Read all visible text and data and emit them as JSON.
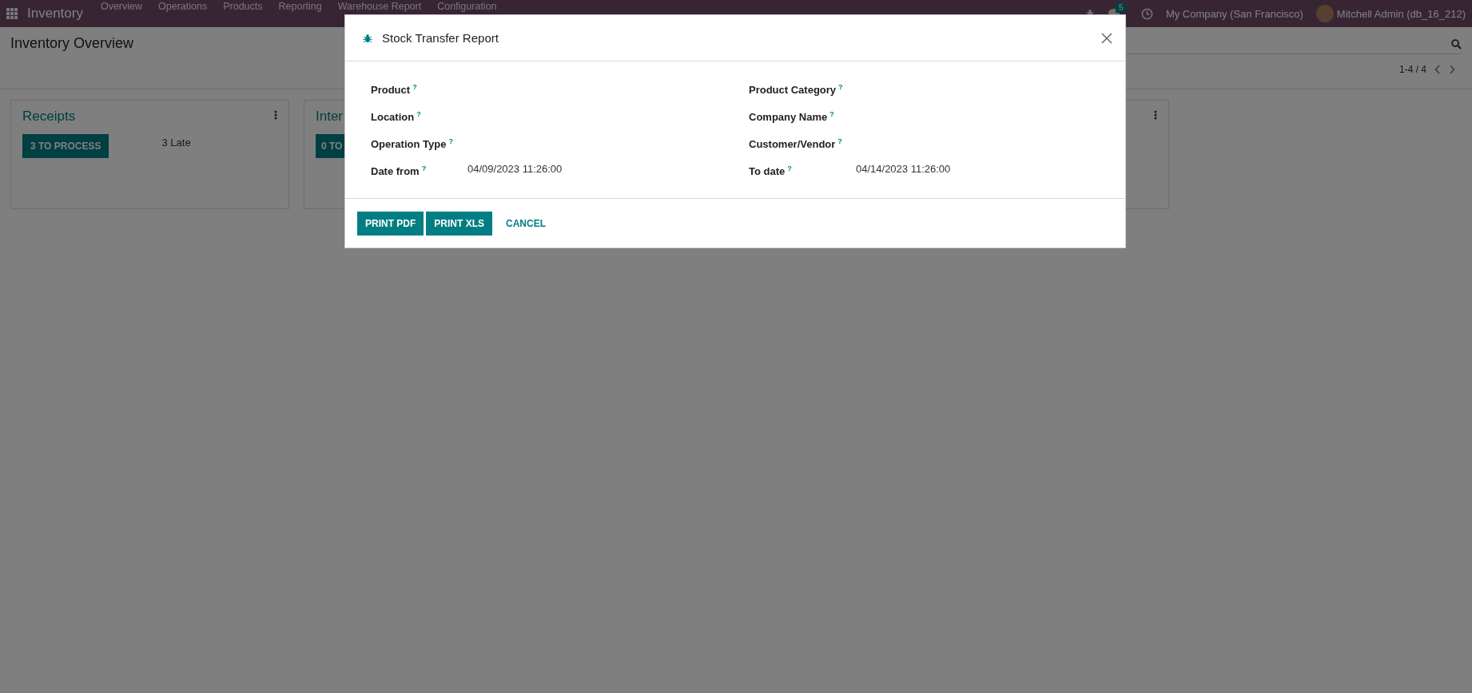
{
  "navbar": {
    "app": "Inventory",
    "menu": [
      "Overview",
      "Operations",
      "Products",
      "Reporting",
      "Warehouse Report",
      "Configuration"
    ],
    "chat_count": "5",
    "company": "My Company (San Francisco)",
    "user": "Mitchell Admin (db_16_212)"
  },
  "page": {
    "title": "Inventory Overview",
    "pager": "1-4 / 4"
  },
  "cards": [
    {
      "kind": "open",
      "title": "Receipts",
      "button": "3 TO PROCESS",
      "late": "3 Late"
    },
    {
      "kind": "cut",
      "title": "Inter",
      "button": "0 TO"
    },
    {
      "kind": "covered"
    }
  ],
  "dialog": {
    "title": "Stock Transfer Report",
    "columns": [
      [
        {
          "label": "Product",
          "help": "?"
        },
        {
          "label": "Location",
          "help": "?"
        },
        {
          "label": "Operation Type",
          "help": "?"
        },
        {
          "label": "Date from",
          "help": "?",
          "value": "04/09/2023 11:26:00"
        }
      ],
      [
        {
          "label": "Product Category",
          "help": "?"
        },
        {
          "label": "Company Name",
          "help": "?"
        },
        {
          "label": "Customer/Vendor",
          "help": "?"
        },
        {
          "label": "To date",
          "help": "?",
          "value": "04/14/2023 11:26:00"
        }
      ]
    ],
    "buttons": [
      {
        "label": "PRINT PDF",
        "kind": "primary"
      },
      {
        "label": "PRINT XLS",
        "kind": "primary"
      },
      {
        "label": "CANCEL",
        "kind": "link"
      }
    ]
  }
}
